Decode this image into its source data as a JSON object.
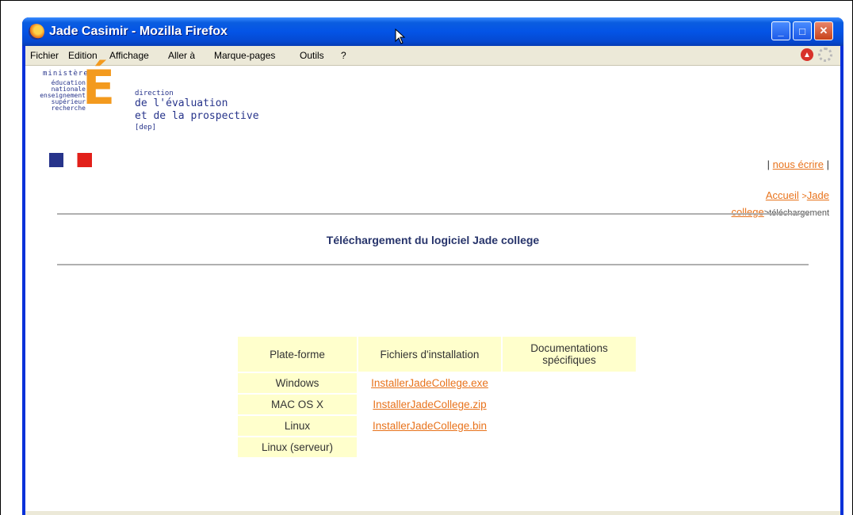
{
  "window": {
    "title": "Jade Casimir - Mozilla Firefox",
    "minimize": "_",
    "maximize": "□",
    "close": "✕"
  },
  "menu": {
    "items": [
      "Fichier",
      "Edition",
      "Affichage",
      "Aller à",
      "Marque-pages",
      "Outils",
      "?"
    ]
  },
  "logo": {
    "ministere": "ministère",
    "edu_lines": [
      "éducation",
      "nationale",
      "enseignement",
      "supérieur",
      "recherche"
    ],
    "dir_lines": [
      "direction",
      "de l'évaluation",
      "et de la prospective",
      "[dep]"
    ],
    "letter": "É"
  },
  "header_links": {
    "nous_ecrire_prefix": "|",
    "nous_ecrire": "nous écrire",
    "nous_ecrire_suffix": "|",
    "accueil": "Accueil",
    "sep": ">",
    "jade": "Jade",
    "college": "college",
    "current": ">téléchargement"
  },
  "page": {
    "heading": "Téléchargement du logiciel Jade college"
  },
  "table": {
    "headers": [
      "Plate-forme",
      "Fichiers d'installation",
      "Documentations spécifiques"
    ],
    "rows": [
      {
        "platform": "Windows",
        "file": "InstallerJadeCollege.exe"
      },
      {
        "platform": "MAC OS X",
        "file": "InstallerJadeCollege.zip"
      },
      {
        "platform": "Linux",
        "file": "InstallerJadeCollege.bin"
      },
      {
        "platform": "Linux (serveur)",
        "file": ""
      }
    ]
  },
  "colors": {
    "link": "#e8731c",
    "cell_bg": "#ffffcc",
    "heading": "#27346b",
    "titlebar": "#0454e6"
  }
}
